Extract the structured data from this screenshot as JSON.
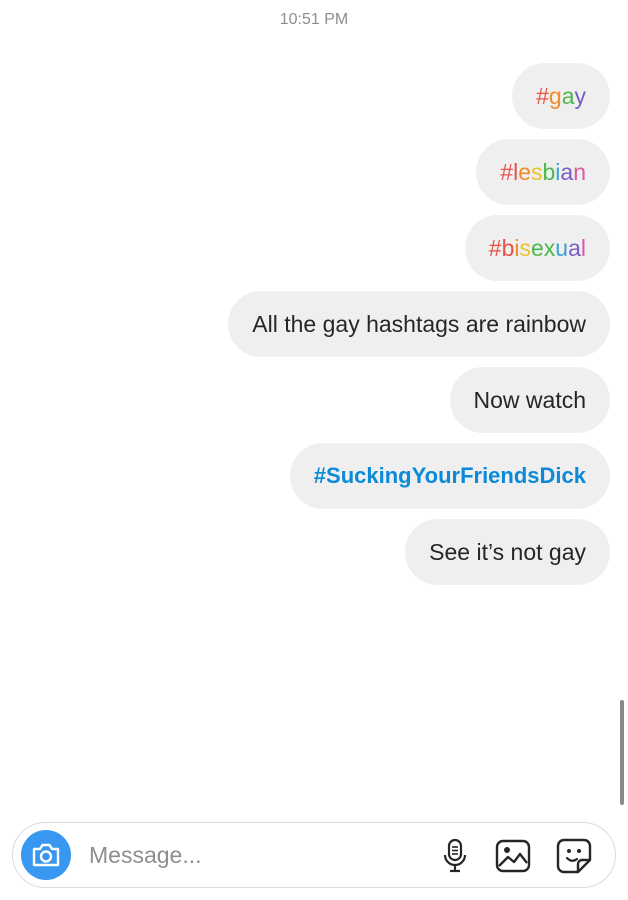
{
  "timestamp": "10:51 PM",
  "messages": [
    {
      "text": "#gay",
      "style": "rainbow"
    },
    {
      "text": "#lesbian",
      "style": "rainbow"
    },
    {
      "text": "#bisexual",
      "style": "rainbow"
    },
    {
      "text": "All the gay hashtags are rainbow",
      "style": "plain"
    },
    {
      "text": "Now watch",
      "style": "plain"
    },
    {
      "text": "#SuckingYourFriendsDick",
      "style": "hashtag-blue"
    },
    {
      "text": "See it’s not gay",
      "style": "plain"
    }
  ],
  "composer": {
    "placeholder": "Message...",
    "icons": [
      "camera-icon",
      "microphone-icon",
      "gallery-icon",
      "sticker-icon"
    ]
  },
  "colors": {
    "accent": "#3897f0",
    "hashtag_blue": "#0a8ad8",
    "bubble": "#efefef",
    "rainbow": [
      "#e8524a",
      "#f08c2c",
      "#e9c42c",
      "#4cb84c",
      "#3aa0d8",
      "#7a5cc8",
      "#d85aa0"
    ]
  }
}
